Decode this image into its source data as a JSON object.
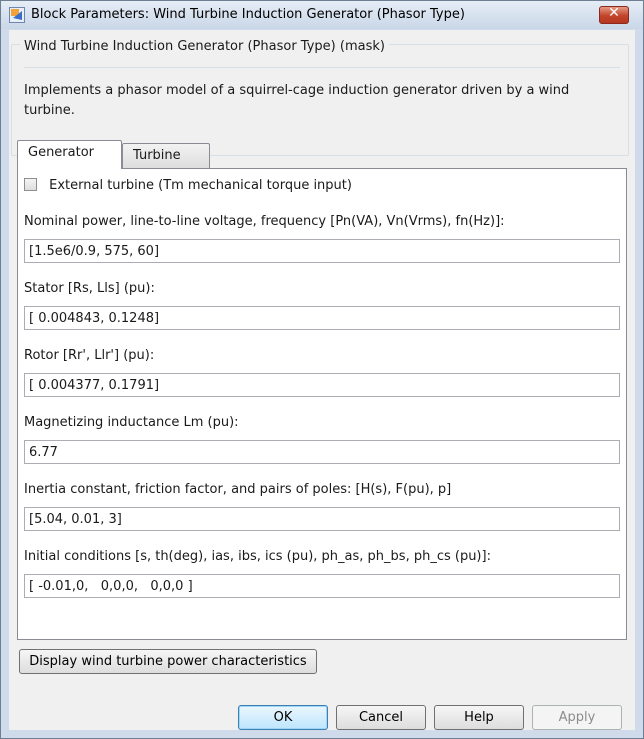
{
  "window": {
    "title": "Block Parameters: Wind Turbine Induction Generator (Phasor Type)",
    "close_symbol": "✕",
    "close_icon": "close-icon",
    "app_icon": "simulink-block-icon"
  },
  "mask": {
    "title": "Wind Turbine Induction Generator (Phasor Type) (mask)",
    "description": "Implements a phasor model of a squirrel-cage induction generator driven by a wind turbine."
  },
  "tabs": [
    {
      "label": "Generator",
      "active": true
    },
    {
      "label": "Turbine",
      "active": false
    }
  ],
  "generator": {
    "external_turbine_label": "External turbine (Tm mechanical torque input)",
    "external_turbine_checked": false,
    "params": [
      {
        "label": "Nominal power, line-to-line voltage, frequency [Pn(VA), Vn(Vrms), fn(Hz)]:",
        "value": "[1.5e6/0.9, 575, 60]"
      },
      {
        "label": "Stator [Rs, Lls] (pu):",
        "value": "[ 0.004843, 0.1248]"
      },
      {
        "label": "Rotor [Rr', Llr'] (pu):",
        "value": "[ 0.004377, 0.1791]"
      },
      {
        "label": "Magnetizing inductance Lm (pu):",
        "value": "6.77"
      },
      {
        "label": "Inertia constant, friction factor, and pairs of poles: [H(s), F(pu), p]",
        "value": "[5.04, 0.01, 3]"
      },
      {
        "label": "Initial conditions [s, th(deg), ias, ibs, ics (pu), ph_as, ph_bs, ph_cs (pu)]:",
        "value": "[ -0.01,0,   0,0,0,   0,0,0 ]"
      }
    ]
  },
  "buttons": {
    "display": "Display wind turbine power characteristics",
    "ok": "OK",
    "cancel": "Cancel",
    "help": "Help",
    "apply": "Apply"
  },
  "colors": {
    "window_frame": "#cfdbea",
    "client_bg": "#f0f0f0",
    "close_red": "#c2442b",
    "ok_accent": "#3c7fb1"
  }
}
